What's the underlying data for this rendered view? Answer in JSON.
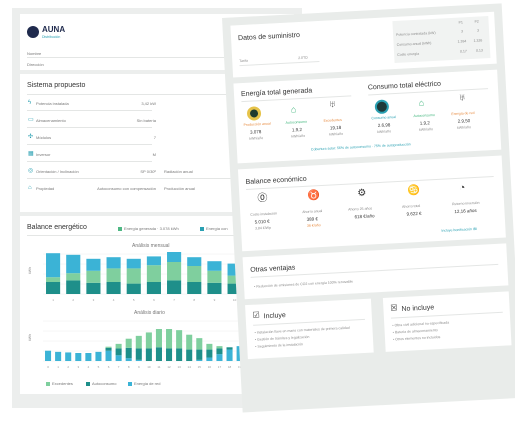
{
  "brand": {
    "name": "AUNA",
    "sub": "Distribución"
  },
  "header_fields": [
    {
      "label": "Nombre"
    },
    {
      "label": "Dirección"
    }
  ],
  "sistema": {
    "title": "Sistema propuesto",
    "rows": [
      {
        "icon": "bolt-icon",
        "label": "Potencia instalada",
        "value": "3,42 kW"
      },
      {
        "icon": "panel-icon",
        "label": "Almacenamiento",
        "value": "Sin batería"
      },
      {
        "icon": "module-icon",
        "label": "Módulos",
        "value": "7"
      },
      {
        "icon": "inverter-icon",
        "label": "Inversor",
        "value": "M"
      },
      {
        "icon": "orientation-icon",
        "label": "Orientación / Inclinación",
        "value": "SP 0/30º"
      },
      {
        "icon": "owner-icon",
        "label": "Propiedad",
        "value": "Autoconsumo con compensación"
      }
    ],
    "side_rows": [
      {
        "label": "Radiación anual",
        "value": "1.627kWh/m²"
      },
      {
        "label": "Producción anual",
        "value": "3.078 kWh"
      }
    ]
  },
  "balance_energetico": {
    "title": "Balance energético",
    "legend_top": [
      {
        "label": "Energía generada · 3.078 kWh",
        "color": "#4fb884"
      },
      {
        "label": "Energía con",
        "color": "#2aa0b2"
      }
    ],
    "monthly_title": "Análisis mensual",
    "daily_title": "Análisis diario",
    "ylabel": "kWh",
    "legend_bottom": [
      {
        "label": "Excedentes",
        "color": "#7fcf9e"
      },
      {
        "label": "Autoconsumo",
        "color": "#1e8f8a"
      },
      {
        "label": "Energía de red",
        "color": "#3bb3d6"
      }
    ]
  },
  "chart_data": [
    {
      "type": "bar",
      "title": "Análisis mensual",
      "ylabel": "kWh",
      "categories": [
        "1",
        "2",
        "3",
        "4",
        "5",
        "6",
        "7",
        "8",
        "9",
        "10",
        "11",
        "12"
      ],
      "series": [
        {
          "name": "Autoconsumo",
          "values": [
            30,
            34,
            28,
            30,
            26,
            30,
            34,
            30,
            28,
            26,
            30,
            22
          ]
        },
        {
          "name": "Excedentes",
          "values": [
            12,
            18,
            30,
            34,
            38,
            42,
            46,
            40,
            30,
            20,
            12,
            8
          ]
        },
        {
          "name": "Energía de red",
          "values": [
            60,
            46,
            30,
            28,
            24,
            22,
            26,
            22,
            24,
            30,
            40,
            56
          ]
        }
      ],
      "ylim": [
        0,
        100
      ]
    },
    {
      "type": "bar",
      "title": "Análisis diario",
      "ylabel": "kWh",
      "categories": [
        "0",
        "1",
        "2",
        "3",
        "4",
        "5",
        "6",
        "7",
        "8",
        "9",
        "10",
        "11",
        "12",
        "13",
        "14",
        "15",
        "16",
        "17",
        "18",
        "19",
        "20",
        "21",
        "22",
        "23"
      ],
      "series": [
        {
          "name": "Autoconsumo",
          "values": [
            0,
            0,
            0,
            0,
            0,
            0,
            0.05,
            0.12,
            0.18,
            0.2,
            0.22,
            0.24,
            0.22,
            0.22,
            0.2,
            0.18,
            0.14,
            0.1,
            0.04,
            0,
            0,
            0,
            0,
            0
          ]
        },
        {
          "name": "Excedentes",
          "values": [
            0,
            0,
            0,
            0,
            0,
            0,
            0.02,
            0.08,
            0.16,
            0.22,
            0.28,
            0.32,
            0.34,
            0.32,
            0.26,
            0.2,
            0.1,
            0.04,
            0,
            0,
            0,
            0,
            0,
            0
          ]
        },
        {
          "name": "Energía de red",
          "values": [
            0.18,
            0.16,
            0.15,
            0.14,
            0.14,
            0.16,
            0.18,
            0.1,
            0.05,
            0.02,
            0,
            0,
            0,
            0,
            0,
            0.02,
            0.06,
            0.12,
            0.2,
            0.26,
            0.3,
            0.28,
            0.24,
            0.2
          ]
        }
      ],
      "ylim": [
        0,
        0.7
      ]
    }
  ],
  "front": {
    "suministro_title": "Datos de suministro",
    "suministro_field": {
      "label": "Tarifa",
      "value": "2.0TD"
    },
    "periods_header": [
      "P1",
      "P2"
    ],
    "periods": [
      {
        "label": "Potencia contratada (kW)",
        "p1": "3",
        "p2": "3"
      },
      {
        "label": "Consumo anual (kWh)",
        "p1": "1.394",
        "p2": "1.326"
      },
      {
        "label": "Coste energía",
        "p1": "0,17",
        "p2": "0,13"
      }
    ],
    "energia_generada_title": "Energía total generada",
    "consumo_title": "Consumo total eléctrico",
    "gen_items": [
      {
        "caption": "Producción anual",
        "value": "3.078",
        "unit": "kWh/año"
      },
      {
        "caption": "Autoconsumo",
        "value": "1.9,2",
        "unit": "kWh/año"
      },
      {
        "caption": "Excedentes",
        "value": "19,18",
        "unit": "kWh/año"
      }
    ],
    "cons_items": [
      {
        "caption": "Consumo anual",
        "value": "2.6,98",
        "unit": "kWh/año"
      },
      {
        "caption": "Autoconsumo",
        "value": "1.9,2",
        "unit": "kWh/año"
      },
      {
        "caption": "Energía de red",
        "value": "2.9,50",
        "unit": "kWh/año"
      }
    ],
    "cobertura_note": "Cobertura solar: 56% de autoconsumo · 75% de autoproducción",
    "balance_title": "Balance económico",
    "econ_items": [
      {
        "caption": "Coste instalación",
        "value": "5.010 €",
        "extra": "3,84 €/Wp"
      },
      {
        "caption": "Ahorro anual",
        "value": "389 €",
        "extra": "36 €/año"
      },
      {
        "caption": "Ahorro 25 años",
        "value": "618 €/año",
        "extra": ""
      },
      {
        "caption": "Ahorro total",
        "value": "9.622 €",
        "extra": ""
      },
      {
        "caption": "Retorno inversión",
        "value": "12,16 años",
        "extra": ""
      }
    ],
    "econ_note": "Incluye bonificación IBI",
    "ventajas_title": "Otras ventajas",
    "ventajas_text": "Reducción de emisiones de CO2 con energía 100% renovable",
    "incluye_title": "Incluye",
    "incluye_items": [
      "Instalación llave en mano con materiales de primera calidad",
      "Gestión de trámites y legalización",
      "Seguimiento de la instalación"
    ],
    "noincluye_title": "No incluye",
    "noincluye_items": [
      "Obra civil adicional no especificada",
      "Batería de almacenamiento",
      "Otros elementos no incluidos"
    ]
  }
}
